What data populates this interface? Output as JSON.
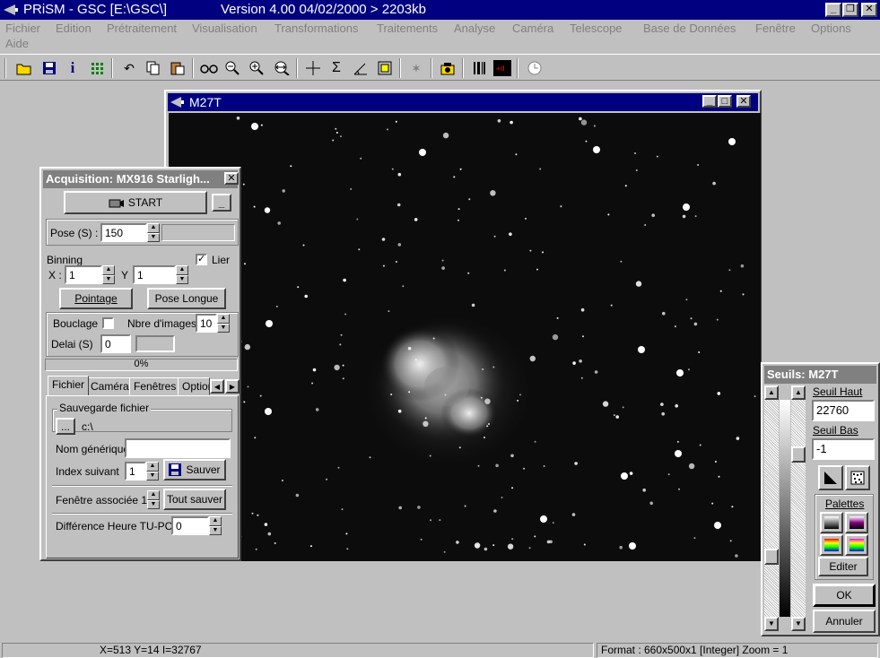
{
  "app": {
    "title_left": "PRiSM - GSC [E:\\GSC\\]",
    "title_right": "Version 4.00   04/02/2000 > 2203kb"
  },
  "menu": [
    "Fichier",
    "Edition",
    "Prétraitement",
    "Visualisation",
    "Transformations",
    "Traitements",
    "Analyse",
    "Caméra",
    "Telescope",
    "Base de Données",
    "Fenêtre",
    "Options",
    "Aide"
  ],
  "toolbar_icons": [
    "open-folder-icon",
    "save-disk-icon",
    "info-icon",
    "grid-icon",
    "undo-icon",
    "copy-icon",
    "paste-icon",
    "glasses-icon",
    "zoom-out-icon",
    "zoom-in-icon",
    "zoom-fit-icon",
    "crosshair-icon",
    "sigma-icon",
    "angle-icon",
    "frame-icon",
    "star-icon",
    "camera-icon",
    "barcode-icon",
    "display-icon",
    "clock-icon"
  ],
  "image_window": {
    "title": "M27T"
  },
  "acquisition": {
    "title": "Acquisition: MX916 Starligh...",
    "start_label": "START",
    "pose_label": "Pose (S) :",
    "pose_value": "150",
    "binning_label": "Binning",
    "x_label": "X :",
    "x_value": "1",
    "y_label": "Y",
    "y_value": "1",
    "lier_label": "Lier",
    "lier_checked": "✓",
    "pointage_label": "Pointage",
    "pose_longue_label": "Pose Longue",
    "bouclage_label": "Bouclage",
    "nbre_images_label": "Nbre d'images",
    "nbre_images_value": "10",
    "delai_label": "Delai (S)",
    "delai_value": "0",
    "progress_text": "0%",
    "progress_fraction": 0,
    "tabs": [
      "Fichier",
      "Caméra",
      "Fenêtres",
      "Option"
    ],
    "sauvegarde_label": "Sauvegarde fichier",
    "browse_label": "...",
    "path_value": "c:\\",
    "nom_generique_label": "Nom générique",
    "nom_generique_value": "",
    "index_label": "Index suivant",
    "index_value": "1",
    "sauver_label": "Sauver",
    "fenetre_label": "Fenêtre associée 1",
    "tout_sauver_label": "Tout sauver",
    "diff_label": "Différence Heure TU-PC :",
    "diff_value": "0"
  },
  "seuils": {
    "title": "Seuils: M27T",
    "haut_label": "Seuil Haut",
    "haut_value": "22760",
    "bas_label": "Seuil Bas",
    "bas_value": "-1",
    "palettes_label": "Palettes",
    "editer_label": "Editer",
    "ok_label": "OK",
    "annuler_label": "Annuler"
  },
  "status": {
    "coords": "X=513 Y=14 I=32767",
    "format": "Format : 660x500x1 [Integer]  Zoom = 1"
  }
}
